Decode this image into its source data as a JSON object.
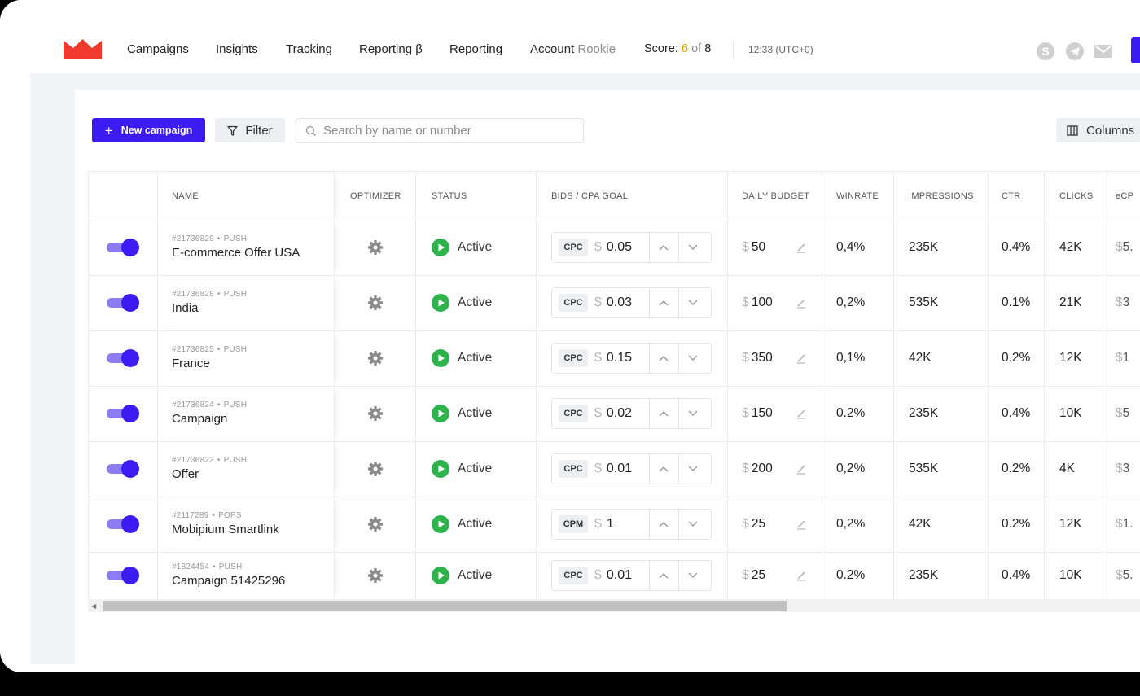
{
  "nav": {
    "items": [
      "Campaigns",
      "Insights",
      "Tracking",
      "Reporting β",
      "Reporting"
    ],
    "account_label": "Account",
    "account_level": "Rookie",
    "score_label": "Score:",
    "score_current": "6",
    "score_of": "of",
    "score_total": "8",
    "clock": "12:33 (UTC+0)"
  },
  "header_icons": [
    "skype-icon",
    "telegram-icon",
    "mail-icon"
  ],
  "toolbar": {
    "new_campaign_label": "New campaign",
    "filter_label": "Filter",
    "search_placeholder": "Search by name or number",
    "columns_label": "Columns"
  },
  "table": {
    "headers": {
      "name": "NAME",
      "optimizer": "OPTIMIZER",
      "status": "STATUS",
      "bids": "BIDS / CPA GOAL",
      "budget": "DAILY BUDGET",
      "winrate": "WINRATE",
      "impressions": "IMPRESSIONS",
      "ctr": "CTR",
      "clicks": "CLICKS",
      "ecpc": "eCP"
    },
    "rows": [
      {
        "id": "#21736829",
        "type": "PUSH",
        "name": "E-commerce Offer USA",
        "status": "Active",
        "bid_type": "CPC",
        "bid": "0.05",
        "budget": "50",
        "winrate": "0,4%",
        "impressions": "235K",
        "ctr": "0.4%",
        "clicks": "42K",
        "ecpc": "5."
      },
      {
        "id": "#21736828",
        "type": "PUSH",
        "name": "India",
        "status": "Active",
        "bid_type": "CPC",
        "bid": "0.03",
        "budget": "100",
        "winrate": "0,2%",
        "impressions": "535K",
        "ctr": "0.1%",
        "clicks": "21K",
        "ecpc": "3"
      },
      {
        "id": "#21736825",
        "type": "PUSH",
        "name": "France",
        "status": "Active",
        "bid_type": "CPC",
        "bid": "0.15",
        "budget": "350",
        "winrate": "0,1%",
        "impressions": "42K",
        "ctr": "0.2%",
        "clicks": "12K",
        "ecpc": "1"
      },
      {
        "id": "#21736824",
        "type": "PUSH",
        "name": "Campaign",
        "status": "Active",
        "bid_type": "CPC",
        "bid": "0.02",
        "budget": "150",
        "winrate": "0.2%",
        "impressions": "235K",
        "ctr": "0.4%",
        "clicks": "10K",
        "ecpc": "5"
      },
      {
        "id": "#21736822",
        "type": "PUSH",
        "name": "Offer",
        "status": "Active",
        "bid_type": "CPC",
        "bid": "0.01",
        "budget": "200",
        "winrate": "0,2%",
        "impressions": "535K",
        "ctr": "0.2%",
        "clicks": "4K",
        "ecpc": "3"
      },
      {
        "id": "#2117289",
        "type": "POPS",
        "name": "Mobipium Smartlink",
        "status": "Active",
        "bid_type": "CPM",
        "bid": "1",
        "budget": "25",
        "winrate": "0,2%",
        "impressions": "42K",
        "ctr": "0.2%",
        "clicks": "12K",
        "ecpc": "1."
      },
      {
        "id": "#1824454",
        "type": "PUSH",
        "name": "Campaign 51425296",
        "status": "Active",
        "bid_type": "CPC",
        "bid": "0.01",
        "budget": "25",
        "winrate": "0.2%",
        "impressions": "235K",
        "ctr": "0.4%",
        "clicks": "10K",
        "ecpc": "5."
      }
    ],
    "currency": "$",
    "meta_separator": "•"
  },
  "colors": {
    "accent": "#3d1cf4",
    "toggle_track": "#8b7cf2",
    "active_green": "#2db34a",
    "logo_red": "#f03a2e",
    "score_yellow": "#e2a800"
  }
}
